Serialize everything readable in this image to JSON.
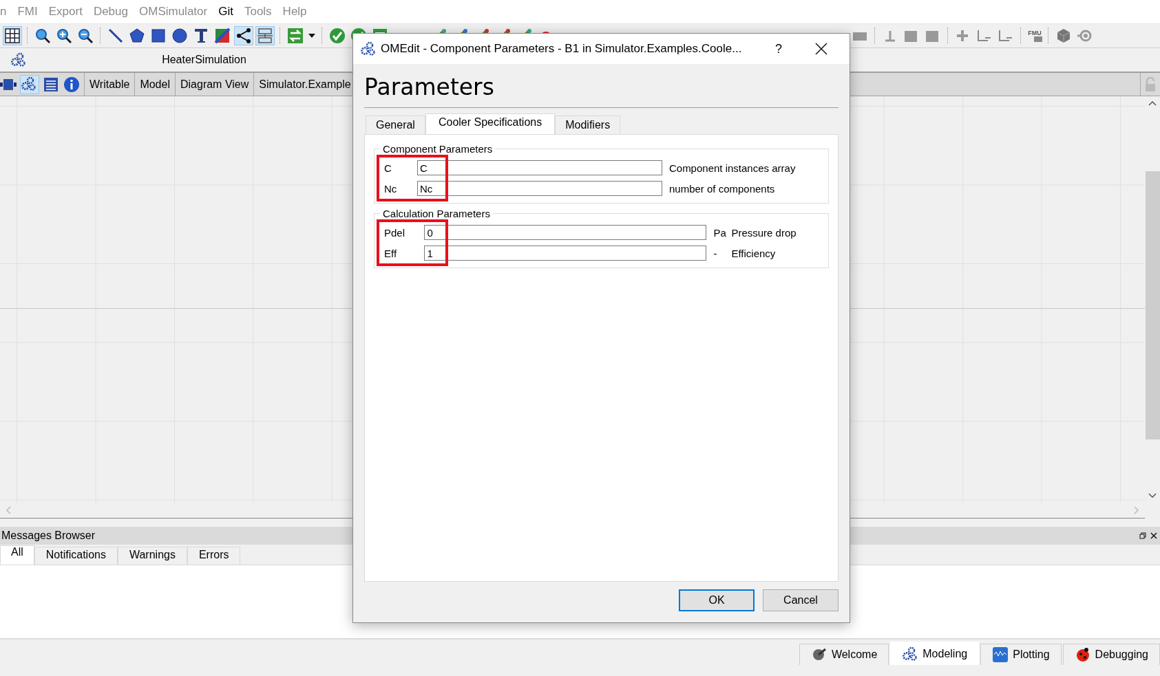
{
  "menu": [
    {
      "label": "n",
      "disabled": true
    },
    {
      "label": "FMI",
      "disabled": true
    },
    {
      "label": "Export",
      "disabled": true
    },
    {
      "label": "Debug",
      "disabled": true
    },
    {
      "label": "OMSimulator",
      "disabled": true
    },
    {
      "label": "Git",
      "disabled": false
    },
    {
      "label": "Tools",
      "disabled": true
    },
    {
      "label": "Help",
      "disabled": true
    }
  ],
  "toolbar": {
    "fmu_label": "FMU"
  },
  "model_tab": {
    "title": "HeaterSimulation"
  },
  "model_toolbar": {
    "items": [
      {
        "label": "Writable"
      },
      {
        "label": "Model"
      },
      {
        "label": "Diagram View"
      },
      {
        "label": "Simulator.Example"
      }
    ]
  },
  "messages": {
    "title": "Messages Browser",
    "tabs": [
      {
        "label": "All",
        "selected": true
      },
      {
        "label": "Notifications",
        "selected": false
      },
      {
        "label": "Warnings",
        "selected": false
      },
      {
        "label": "Errors",
        "selected": false
      }
    ]
  },
  "perspectives": [
    {
      "label": "Welcome",
      "selected": false
    },
    {
      "label": "Modeling",
      "selected": true
    },
    {
      "label": "Plotting",
      "selected": false
    },
    {
      "label": "Debugging",
      "selected": false
    }
  ],
  "dialog": {
    "title": "OMEdit - Component Parameters - B1 in Simulator.Examples.Coole...",
    "help": "?",
    "heading": "Parameters",
    "tabs": [
      {
        "label": "General",
        "selected": false
      },
      {
        "label": "Cooler Specifications",
        "selected": true
      },
      {
        "label": "Modifiers",
        "selected": false
      }
    ],
    "groups": [
      {
        "title": "Component Parameters",
        "highlighted": true,
        "rows": [
          {
            "name": "C",
            "value": "C",
            "description": "Component instances array"
          },
          {
            "name": "Nc",
            "value": "Nc",
            "description": "number of components"
          }
        ]
      },
      {
        "title": "Calculation Parameters",
        "highlighted": true,
        "rows": [
          {
            "name": "Pdel",
            "value": "0",
            "unit": "Pa",
            "description": "Pressure drop"
          },
          {
            "name": "Eff",
            "value": "1",
            "unit": "-",
            "description": "Efficiency"
          }
        ]
      }
    ],
    "buttons": [
      {
        "label": "OK",
        "default": true
      },
      {
        "label": "Cancel",
        "default": false
      }
    ]
  }
}
